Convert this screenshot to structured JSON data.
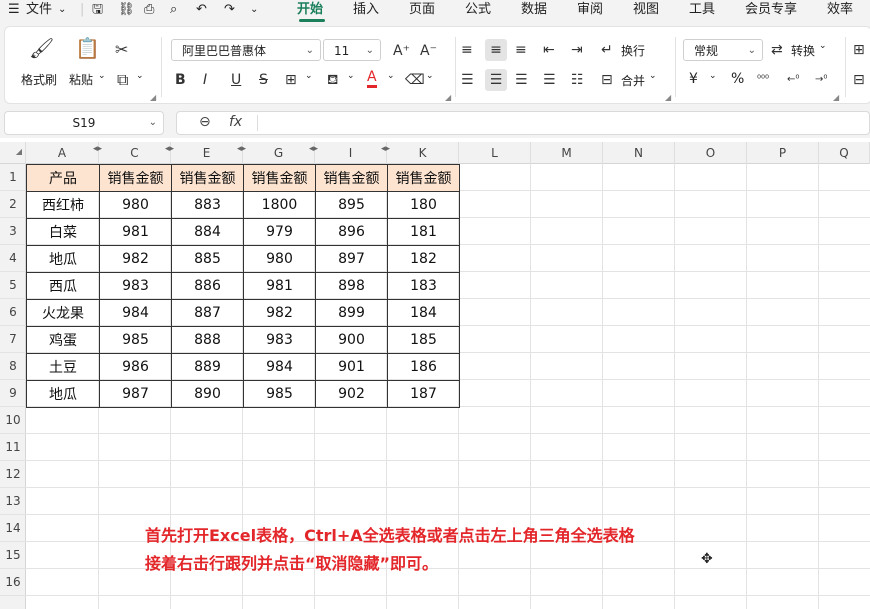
{
  "menubar": {
    "menu_icon": "hamburger-icon",
    "file_label": "文件",
    "tabs": [
      "开始",
      "插入",
      "页面",
      "公式",
      "数据",
      "审阅",
      "视图",
      "工具",
      "会员专享",
      "效率"
    ],
    "active_tab": "开始",
    "accent_color": "#1a7f5a"
  },
  "ribbon": {
    "format_painter": "格式刷",
    "paste": "粘贴",
    "font_name": "阿里巴巴普惠体",
    "font_size": "11",
    "wrap_text": "换行",
    "merge": "合并",
    "number_format": "常规",
    "convert": "转换",
    "currency_symbol": "¥",
    "percent_symbol": "%",
    "font_color": "#e3262a"
  },
  "formula_bar": {
    "name_box": "S19",
    "fx_label": "fx",
    "content": ""
  },
  "grid": {
    "columns": [
      "A",
      "C",
      "E",
      "G",
      "I",
      "K",
      "L",
      "M",
      "N",
      "O",
      "P",
      "Q"
    ],
    "rows": [
      "1",
      "2",
      "3",
      "4",
      "5",
      "6",
      "7",
      "8",
      "9",
      "10",
      "11",
      "12",
      "13",
      "14",
      "15",
      "16"
    ],
    "header_fill": "#fce4d0"
  },
  "table": {
    "headers": [
      "产品",
      "销售金额",
      "销售金额",
      "销售金额",
      "销售金额",
      "销售金额"
    ],
    "rows": [
      [
        "西红柿",
        "980",
        "883",
        "1800",
        "895",
        "180"
      ],
      [
        "白菜",
        "981",
        "884",
        "979",
        "896",
        "181"
      ],
      [
        "地瓜",
        "982",
        "885",
        "980",
        "897",
        "182"
      ],
      [
        "西瓜",
        "983",
        "886",
        "981",
        "898",
        "183"
      ],
      [
        "火龙果",
        "984",
        "887",
        "982",
        "899",
        "184"
      ],
      [
        "鸡蛋",
        "985",
        "888",
        "983",
        "900",
        "185"
      ],
      [
        "土豆",
        "986",
        "889",
        "984",
        "901",
        "186"
      ],
      [
        "地瓜",
        "987",
        "890",
        "985",
        "902",
        "187"
      ]
    ]
  },
  "caption": {
    "line1": "首先打开Excel表格，Ctrl+A全选表格或者点击左上角三角全选表格",
    "line2": "接着右击行跟列并点击“取消隐藏”即可。",
    "color": "#e3262a"
  }
}
